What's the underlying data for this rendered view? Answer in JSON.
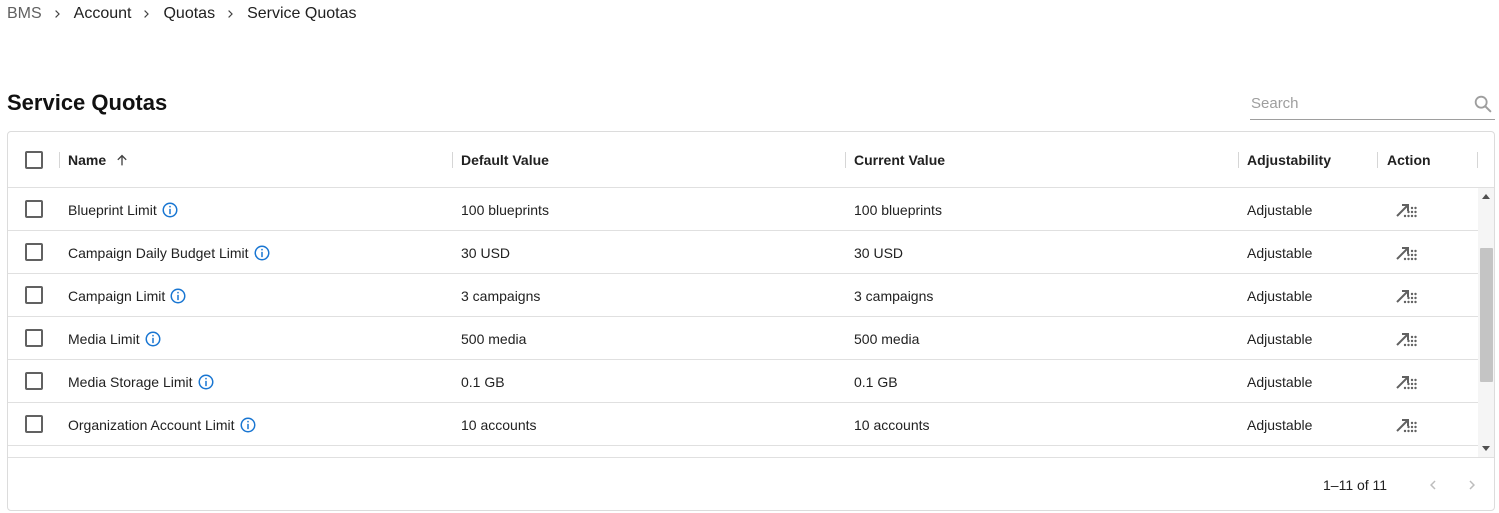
{
  "breadcrumb": {
    "items": [
      "BMS",
      "Account",
      "Quotas",
      "Service Quotas"
    ]
  },
  "page": {
    "title": "Service Quotas"
  },
  "search": {
    "placeholder": "Search",
    "value": "",
    "icon": "search-icon"
  },
  "table": {
    "columns": {
      "name": "Name",
      "default_value": "Default Value",
      "current_value": "Current Value",
      "adjustability": "Adjustability",
      "action": "Action"
    },
    "sort": {
      "column": "name",
      "direction": "ascending",
      "icon": "arrow-up-icon"
    },
    "rows": [
      {
        "name": "Blueprint Limit",
        "default_value": "100 blueprints",
        "current_value": "100 blueprints",
        "adjustability": "Adjustable"
      },
      {
        "name": "Campaign Daily Budget Limit",
        "default_value": "30 USD",
        "current_value": "30 USD",
        "adjustability": "Adjustable"
      },
      {
        "name": "Campaign Limit",
        "default_value": "3 campaigns",
        "current_value": "3 campaigns",
        "adjustability": "Adjustable"
      },
      {
        "name": "Media Limit",
        "default_value": "500 media",
        "current_value": "500 media",
        "adjustability": "Adjustable"
      },
      {
        "name": "Media Storage Limit",
        "default_value": "0.1 GB",
        "current_value": "0.1 GB",
        "adjustability": "Adjustable"
      },
      {
        "name": "Organization Account Limit",
        "default_value": "10 accounts",
        "current_value": "10 accounts",
        "adjustability": "Adjustable"
      }
    ]
  },
  "pagination": {
    "info": "1–11 of 11",
    "prev_icon": "chevron-left-icon",
    "next_icon": "chevron-right-icon"
  },
  "colors": {
    "info_icon": "#1976d2",
    "action_icon": "#616161",
    "border": "#e0e0e0"
  }
}
